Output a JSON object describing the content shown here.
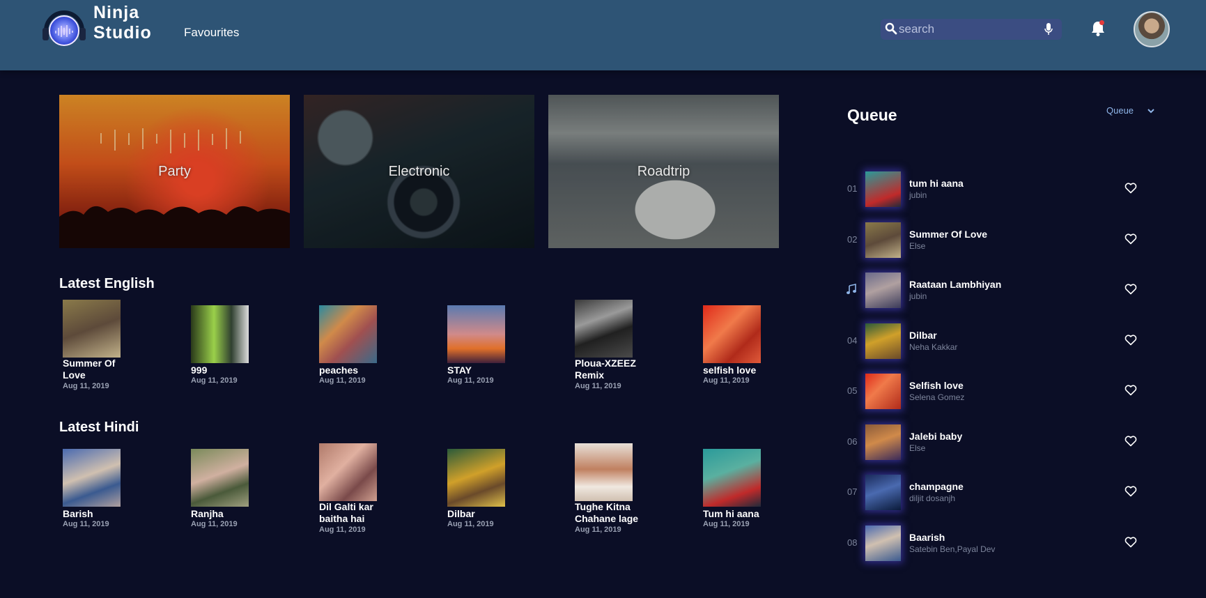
{
  "header": {
    "brand_line1": "Ninja",
    "brand_line2": "Studio",
    "nav_favourites": "Favourites",
    "search_placeholder": "search"
  },
  "categories": [
    {
      "label": "Party"
    },
    {
      "label": "Electronic"
    },
    {
      "label": "Roadtrip"
    }
  ],
  "latest_english": {
    "title": "Latest English",
    "items": [
      {
        "title": "Summer Of Love",
        "date": "Aug 11, 2019"
      },
      {
        "title": "999",
        "date": "Aug 11, 2019"
      },
      {
        "title": "peaches",
        "date": "Aug 11, 2019"
      },
      {
        "title": "STAY",
        "date": "Aug 11, 2019"
      },
      {
        "title": "Ploua-XZEEZ Remix",
        "date": "Aug 11, 2019"
      },
      {
        "title": "selfish love",
        "date": "Aug 11, 2019"
      }
    ]
  },
  "latest_hindi": {
    "title": "Latest Hindi",
    "items": [
      {
        "title": "Barish",
        "date": "Aug 11, 2019"
      },
      {
        "title": "Ranjha",
        "date": "Aug 11, 2019"
      },
      {
        "title": "Dil Galti kar baitha hai",
        "date": "Aug 11, 2019"
      },
      {
        "title": "Dilbar",
        "date": "Aug 11, 2019"
      },
      {
        "title": "Tughe Kitna Chahane lage",
        "date": "Aug 11, 2019"
      },
      {
        "title": "Tum hi aana",
        "date": "Aug 11, 2019"
      }
    ]
  },
  "queue": {
    "title": "Queue",
    "select_value": "Queue",
    "now_playing_index": 2,
    "items": [
      {
        "num": "01",
        "title": "tum hi aana",
        "artist": "jubin"
      },
      {
        "num": "02",
        "title": "Summer Of Love",
        "artist": "Else"
      },
      {
        "num": "",
        "title": "Raataan Lambhiyan",
        "artist": "jubin"
      },
      {
        "num": "04",
        "title": "Dilbar",
        "artist": "Neha Kakkar"
      },
      {
        "num": "05",
        "title": "Selfish love",
        "artist": "Selena Gomez"
      },
      {
        "num": "06",
        "title": "Jalebi baby",
        "artist": "Else"
      },
      {
        "num": "07",
        "title": "champagne",
        "artist": "diljit dosanjh"
      },
      {
        "num": "08",
        "title": "Baarish",
        "artist": "Satebin Ben,Payal Dev"
      }
    ]
  },
  "colors": {
    "header_bg": "#2e5475",
    "page_bg": "#0b0e26",
    "accent": "#8fb5e8"
  }
}
